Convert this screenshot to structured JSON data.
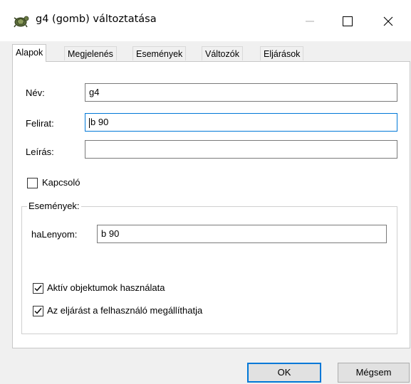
{
  "window": {
    "title": "g4 (gomb) változtatása",
    "minimize_icon": "minimize-icon",
    "maximize_icon": "maximize-icon",
    "close_icon": "close-icon"
  },
  "tabs": [
    {
      "label": "Alapok",
      "active": true
    },
    {
      "label": "Megjelenés",
      "active": false
    },
    {
      "label": "Események",
      "active": false
    },
    {
      "label": "Változók",
      "active": false
    },
    {
      "label": "Eljárások",
      "active": false
    }
  ],
  "form": {
    "name_label": "Név:",
    "name_value": "g4",
    "caption_label": "Felirat:",
    "caption_value": "b 90",
    "description_label": "Leírás:",
    "description_value": "",
    "switch_label": "Kapcsoló",
    "switch_checked": false
  },
  "events_group": {
    "title": "Események:",
    "on_press_label": "haLenyom:",
    "on_press_value": "b 90",
    "active_objects_label": "Aktív objektumok használata",
    "active_objects_checked": true,
    "user_stop_label": "Az eljárást a felhasználó megállíthatja",
    "user_stop_checked": true
  },
  "buttons": {
    "ok_label": "OK",
    "cancel_label": "Mégsem"
  },
  "colors": {
    "focus_border": "#0078d7",
    "window_bg": "#f0f0f0",
    "panel_bg": "#ffffff"
  }
}
